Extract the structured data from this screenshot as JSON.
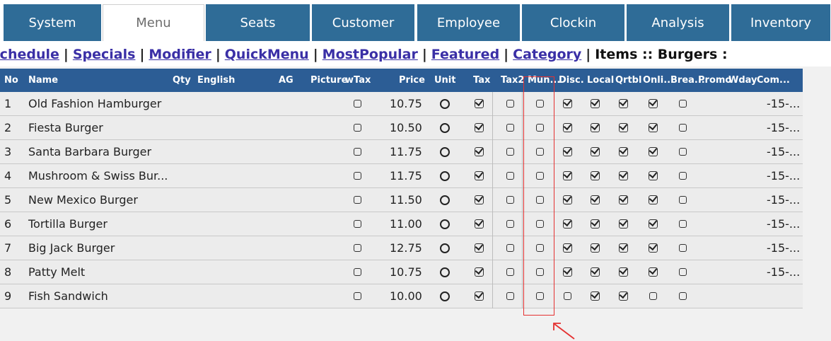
{
  "nav": {
    "tabs": [
      {
        "label": "System",
        "active": false
      },
      {
        "label": "Menu",
        "active": true
      },
      {
        "label": "Seats",
        "active": false
      },
      {
        "label": "Customer",
        "active": false
      },
      {
        "label": "Employee",
        "active": false
      },
      {
        "label": "Clockin",
        "active": false
      },
      {
        "label": "Analysis",
        "active": false
      },
      {
        "label": "Inventory",
        "active": false
      }
    ]
  },
  "subnav": {
    "links": [
      "Schedule",
      "Specials",
      "Modifier",
      "QuickMenu",
      "MostPopular",
      "Featured",
      "Category"
    ],
    "crumb": "Items :: Burgers :"
  },
  "table": {
    "headers": [
      "No",
      "Name",
      "Qty",
      "English",
      "AG",
      "Picture",
      "wTax",
      "Price",
      "Unit",
      "Tax",
      "Tax2",
      "Mun...",
      "Disc.",
      "Local",
      "Qrtbl",
      "Onli...",
      "Brea...",
      "Promo",
      "Wday",
      "Com..."
    ],
    "rows": [
      {
        "no": "1",
        "name": "Old Fashion Hamburger",
        "wtax": false,
        "price": "10.75",
        "tax": true,
        "tax2": false,
        "mun": false,
        "disc": true,
        "local": true,
        "qrtbl": true,
        "onli": true,
        "brea": false,
        "com": "-15-..."
      },
      {
        "no": "2",
        "name": "Fiesta Burger",
        "wtax": false,
        "price": "10.50",
        "tax": true,
        "tax2": false,
        "mun": false,
        "disc": true,
        "local": true,
        "qrtbl": true,
        "onli": true,
        "brea": false,
        "com": "-15-..."
      },
      {
        "no": "3",
        "name": "Santa Barbara Burger",
        "wtax": false,
        "price": "11.75",
        "tax": true,
        "tax2": false,
        "mun": false,
        "disc": true,
        "local": true,
        "qrtbl": true,
        "onli": true,
        "brea": false,
        "com": "-15-..."
      },
      {
        "no": "4",
        "name": "Mushroom & Swiss Bur...",
        "wtax": false,
        "price": "11.75",
        "tax": true,
        "tax2": false,
        "mun": false,
        "disc": true,
        "local": true,
        "qrtbl": true,
        "onli": true,
        "brea": false,
        "com": "-15-..."
      },
      {
        "no": "5",
        "name": "New Mexico Burger",
        "wtax": false,
        "price": "11.50",
        "tax": true,
        "tax2": false,
        "mun": false,
        "disc": true,
        "local": true,
        "qrtbl": true,
        "onli": true,
        "brea": false,
        "com": "-15-..."
      },
      {
        "no": "6",
        "name": "Tortilla Burger",
        "wtax": false,
        "price": "11.00",
        "tax": true,
        "tax2": false,
        "mun": false,
        "disc": true,
        "local": true,
        "qrtbl": true,
        "onli": true,
        "brea": false,
        "com": "-15-..."
      },
      {
        "no": "7",
        "name": "Big Jack Burger",
        "wtax": false,
        "price": "12.75",
        "tax": true,
        "tax2": false,
        "mun": false,
        "disc": true,
        "local": true,
        "qrtbl": true,
        "onli": true,
        "brea": false,
        "com": "-15-..."
      },
      {
        "no": "8",
        "name": "Patty Melt",
        "wtax": false,
        "price": "10.75",
        "tax": true,
        "tax2": false,
        "mun": false,
        "disc": true,
        "local": true,
        "qrtbl": true,
        "onli": true,
        "brea": false,
        "com": "-15-..."
      },
      {
        "no": "9",
        "name": "Fish Sandwich",
        "wtax": false,
        "price": "10.00",
        "tax": true,
        "tax2": false,
        "mun": false,
        "disc": false,
        "local": true,
        "qrtbl": true,
        "onli": false,
        "brea": false,
        "com": ""
      }
    ]
  },
  "annotation": {
    "color": "#e53030"
  }
}
